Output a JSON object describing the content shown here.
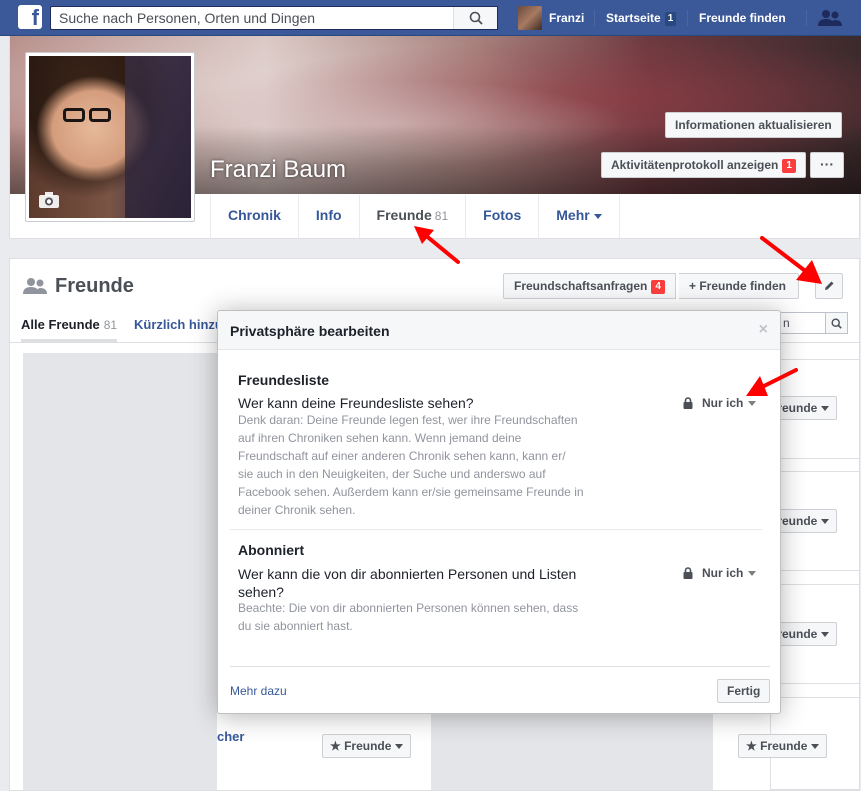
{
  "topbar": {
    "search_placeholder": "Suche nach Personen, Orten und Dingen",
    "user_name": "Franzi",
    "home_label": "Startseite",
    "home_count": "1",
    "find_friends_label": "Freunde finden"
  },
  "profile": {
    "name": "Franzi Baum",
    "update_info_label": "Informationen aktualisieren",
    "activity_log_label": "Aktivitätenprotokoll anzeigen",
    "activity_log_count": "1",
    "more_dots": "···",
    "tabs": [
      {
        "label": "Chronik",
        "count": ""
      },
      {
        "label": "Info",
        "count": ""
      },
      {
        "label": "Freunde",
        "count": "81"
      },
      {
        "label": "Fotos",
        "count": ""
      },
      {
        "label": "Mehr",
        "count": ""
      }
    ]
  },
  "friends": {
    "title": "Freunde",
    "requests_label": "Freundschaftsanfragen",
    "requests_count": "4",
    "find_label": "+ Freunde finden",
    "subtab_all": "Alle Freunde",
    "subtab_all_count": "81",
    "subtab_recent": "Kürzlich hinzu",
    "search_fragment": "n",
    "friend_button_label": "Freunde",
    "partial_name": "cher"
  },
  "dialog": {
    "title": "Privatsphäre bearbeiten",
    "close": "×",
    "section1": {
      "title": "Freundesliste",
      "question": "Wer kann deine Freundesliste sehen?",
      "desc_lines": [
        "Denk daran: Deine Freunde legen fest, wer ihre Freundschaften",
        "auf ihren Chroniken sehen kann. Wenn jemand deine",
        "Freundschaft auf einer anderen Chronik sehen kann, kann er/",
        "sie auch in den Neuigkeiten, der Suche und anderswo auf",
        "Facebook sehen. Außerdem kann er/sie gemeinsame Freunde in",
        "deiner Chronik sehen."
      ],
      "privacy": "Nur ich"
    },
    "section2": {
      "title": "Abonniert",
      "question_lines": [
        "Wer kann die von dir abonnierten Personen und Listen",
        "sehen?"
      ],
      "desc_lines": [
        "Beachte: Die von dir abonnierten Personen können sehen, dass",
        "du sie abonniert hast."
      ],
      "privacy": "Nur ich"
    },
    "more_link": "Mehr dazu",
    "done_label": "Fertig"
  },
  "colors": {
    "brand_blue": "#3b5998",
    "link_blue": "#365899",
    "badge_red": "#fa3e3e",
    "annotation_red": "#ff0000"
  },
  "icons": [
    "facebook-logo-icon",
    "search-icon",
    "friends-requests-icon",
    "camera-icon",
    "friends-icon",
    "pencil-icon",
    "lock-icon",
    "star-icon",
    "caret-down-icon",
    "annotation-arrow"
  ]
}
